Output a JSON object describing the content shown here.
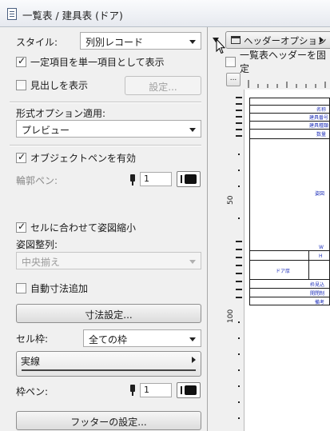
{
  "window": {
    "title": "一覧表 /  建具表 (ドア)"
  },
  "panel": {
    "style_label": "スタイル:",
    "style_value": "列別レコード",
    "fixed_items_label": "一定項目を単一項目として表示",
    "fixed_items_checked": true,
    "show_heading_label": "見出しを表示",
    "show_heading_checked": false,
    "settings_button": "設定...",
    "format_option_label": "形式オプション適用:",
    "format_option_value": "プレビュー",
    "object_pen_label": "オブジェクトペンを有効",
    "object_pen_checked": true,
    "outline_pen_label": "輪郭ペン:",
    "outline_pen_number": "1",
    "fit_cell_label": "セルに合わせて姿図縮小",
    "fit_cell_checked": true,
    "figure_align_label": "姿図整列:",
    "figure_align_value": "中央揃え",
    "auto_dim_label": "自動寸法追加",
    "auto_dim_checked": false,
    "dim_settings_button": "寸法設定...",
    "cell_frame_label": "セル枠:",
    "cell_frame_value": "全ての枠",
    "line_type_value": "実線",
    "frame_pen_label": "枠ペン:",
    "frame_pen_number": "1",
    "footer_button": "フッターの設定..."
  },
  "preview": {
    "header_option_button": "ヘッダーオプション",
    "list_header_fixed_label": "一覧表ヘッダーを固定",
    "list_header_fixed_checked": false,
    "ruler_corner": "...",
    "ruler_marks": [
      "50",
      "100"
    ],
    "cells": {
      "name": "名称",
      "fitting_no": "建具番号",
      "fitting_type": "建具種類",
      "quantity": "数量",
      "figure": "姿図",
      "w": "W",
      "h": "H",
      "door_thickness": "ドア厚",
      "frame_wrap": "枠見込",
      "opening_system": "開閉制",
      "remarks": "備考"
    }
  },
  "colors": {
    "preview_text": "#2233bb",
    "window_bg": "#f0f0f0"
  }
}
